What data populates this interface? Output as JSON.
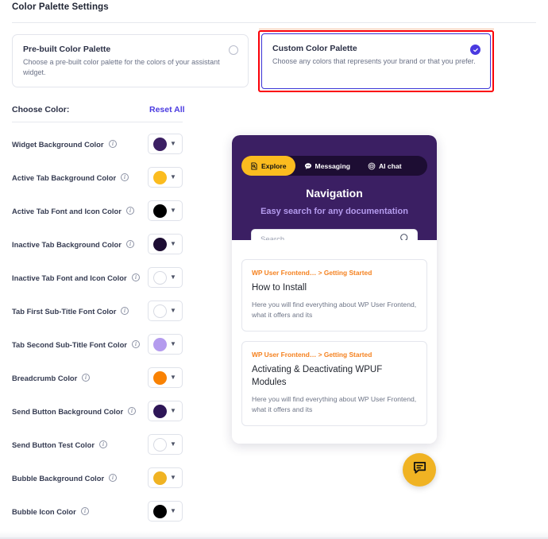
{
  "header": {
    "title": "Color Palette Settings"
  },
  "palette_options": [
    {
      "id": "prebuilt",
      "title": "Pre-built Color Palette",
      "description": "Choose a pre-built color palette for the colors of your assistant widget.",
      "selected": false,
      "radio_icon": "radio-unchecked-icon"
    },
    {
      "id": "custom",
      "title": "Custom Color Palette",
      "description": "Choose any colors that represents your brand or that you prefer.",
      "selected": true,
      "radio_icon": "radio-checked-icon"
    }
  ],
  "highlight": {
    "color": "#fb0007",
    "target": "custom-color-palette-card"
  },
  "choose_color": {
    "label": "Choose Color:",
    "reset_label": "Reset All",
    "reset_color": "#4a3ae0"
  },
  "color_rows": [
    {
      "label": "Widget Background Color",
      "color": "#3b1f63",
      "info_icon": "info-icon",
      "light": false
    },
    {
      "label": "Active Tab Background Color",
      "color": "#fbbc1f",
      "info_icon": "info-icon",
      "light": false
    },
    {
      "label": "Active Tab Font and Icon Color",
      "color": "#000000",
      "info_icon": "info-icon",
      "light": false
    },
    {
      "label": "Inactive Tab Background Color",
      "color": "#1d0d33",
      "info_icon": "info-icon",
      "light": false
    },
    {
      "label": "Inactive Tab Font and Icon Color",
      "color": "#ffffff",
      "info_icon": "info-icon",
      "light": true
    },
    {
      "label": "Tab First Sub-Title Font Color",
      "color": "#ffffff",
      "info_icon": "info-icon",
      "light": true
    },
    {
      "label": "Tab Second Sub-Title Font Color",
      "color": "#b49bee",
      "info_icon": "info-icon",
      "light": false
    },
    {
      "label": "Breadcrumb Color",
      "color": "#f98203",
      "info_icon": "info-icon",
      "light": false
    },
    {
      "label": "Send Button Background Color",
      "color": "#2e1657",
      "info_icon": "info-icon",
      "light": false
    },
    {
      "label": "Send Button Test Color",
      "color": "#ffffff",
      "info_icon": "info-icon",
      "light": true
    },
    {
      "label": "Bubble Background Color",
      "color": "#f0b323",
      "info_icon": "info-icon",
      "light": false
    },
    {
      "label": "Bubble Icon Color",
      "color": "#000000",
      "info_icon": "info-icon",
      "light": false
    }
  ],
  "widget_preview": {
    "tabs": [
      {
        "label": "Explore",
        "icon": "document-explore-icon",
        "active": true
      },
      {
        "label": "Messaging",
        "icon": "chat-dots-icon",
        "active": false
      },
      {
        "label": "AI chat",
        "icon": "robot-face-icon",
        "active": false
      }
    ],
    "heading": "Navigation",
    "subheading": "Easy search for any documentation",
    "search": {
      "placeholder": "Search",
      "value": "",
      "icon": "search-icon"
    },
    "docs": [
      {
        "breadcrumb": "WP User Frontend… > Getting Started",
        "title": "How to Install",
        "excerpt": "Here you will find everything about WP User Frontend, what it offers and its"
      },
      {
        "breadcrumb": "WP User Frontend… > Getting Started",
        "title": "Activating & Deactivating WPUF Modules",
        "excerpt": "Here you will find everything about WP User Frontend, what it offers and its"
      }
    ],
    "bubble": {
      "icon": "chat-bubble-icon",
      "background": "#f0b323"
    }
  }
}
